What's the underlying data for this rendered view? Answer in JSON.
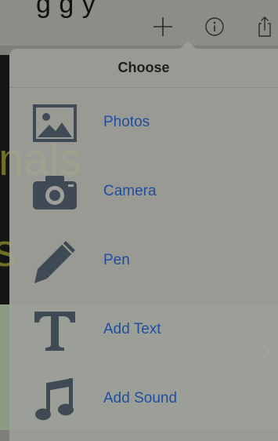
{
  "background": {
    "partial_title": "g      g     y",
    "yellow_text_1": "nals",
    "yellow_text_2": "s"
  },
  "toolbar": {
    "add_icon": "plus-icon",
    "info_icon": "info-icon",
    "share_icon": "share-icon"
  },
  "popover": {
    "title": "Choose",
    "items": [
      {
        "label": "Photos",
        "icon": "photos-icon"
      },
      {
        "label": "Camera",
        "icon": "camera-icon"
      },
      {
        "label": "Pen",
        "icon": "pen-icon"
      },
      {
        "label": "Add Text",
        "icon": "text-icon"
      },
      {
        "label": "Add Sound",
        "icon": "music-note-icon"
      }
    ]
  },
  "colors": {
    "accent": "#1f4d9e",
    "icon": "#3f4a55",
    "overlay": "#7f7f79"
  }
}
